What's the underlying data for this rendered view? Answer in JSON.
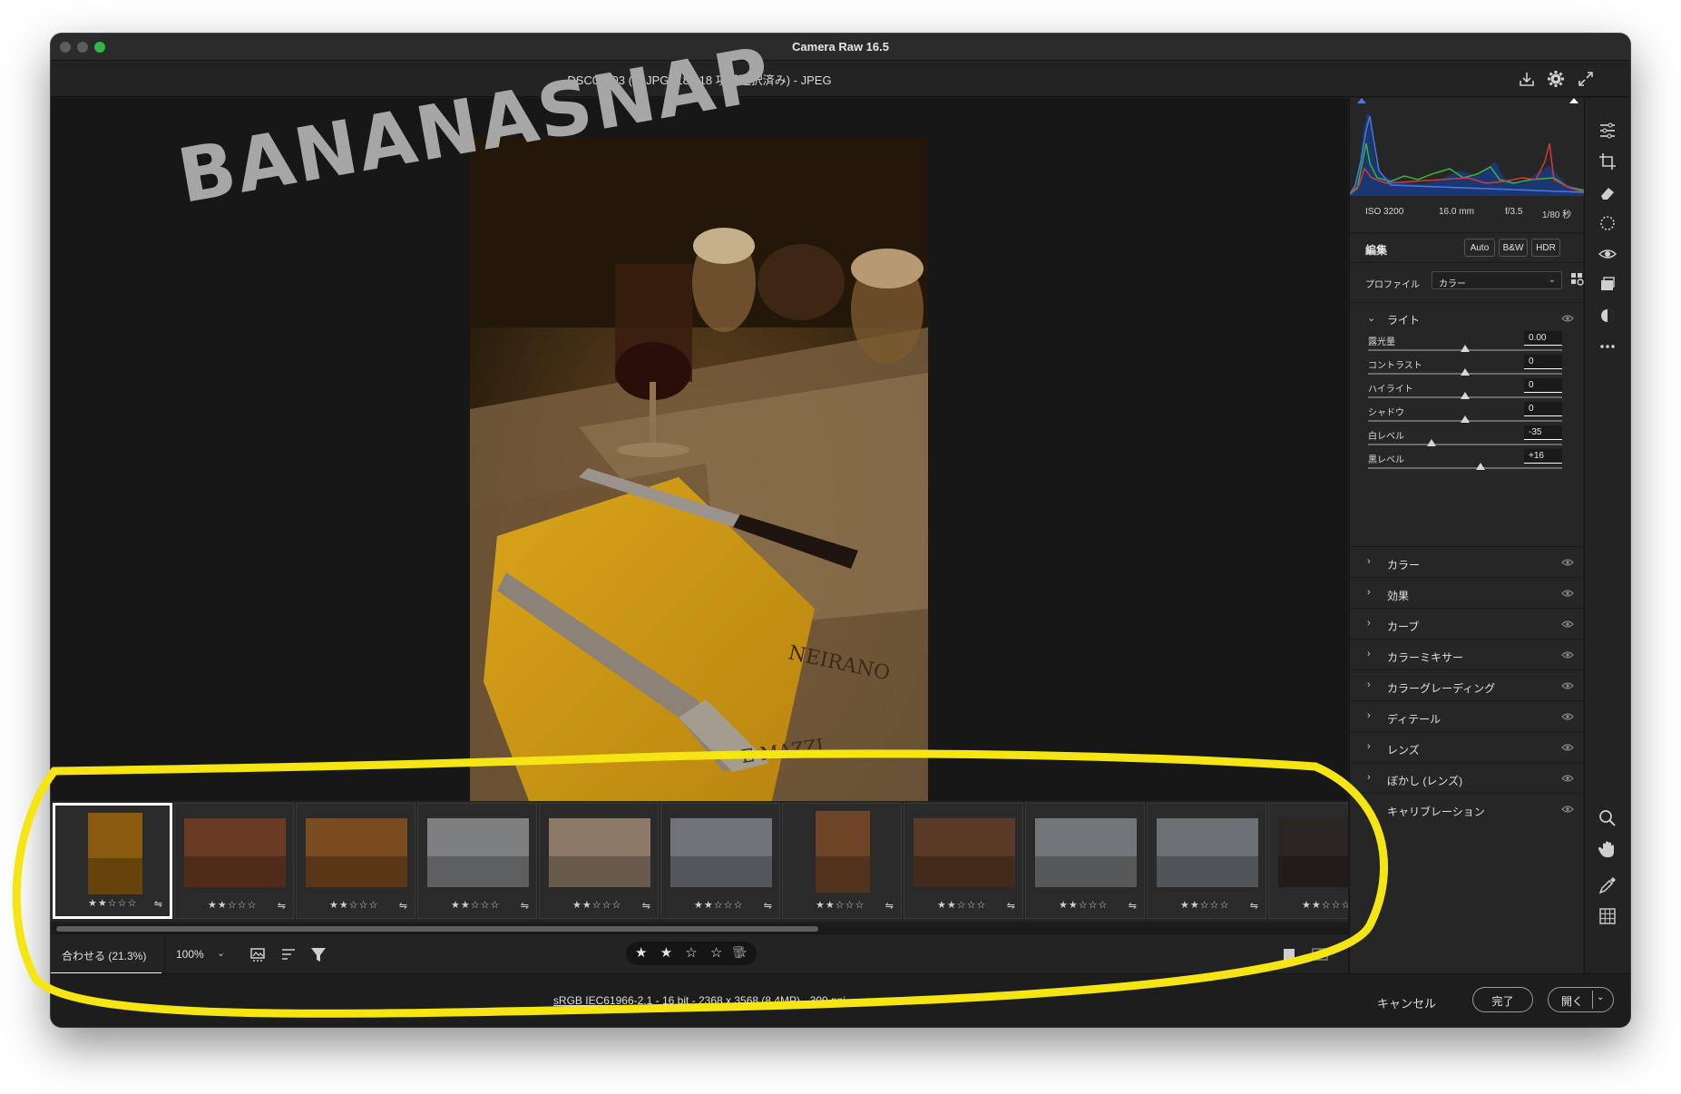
{
  "window": {
    "title": "Camera Raw 16.5"
  },
  "header": {
    "file_title": "DSC00003 (2).JPG (18 / 18 項目選択済み)  -  JPEG"
  },
  "icons": {
    "save": "download-icon",
    "settings": "gear-icon",
    "fullscreen": "expand-icon"
  },
  "watermark": "BANANASNAP",
  "annotation_color": "#f5e613",
  "histogram": {
    "exif": {
      "iso": "ISO 3200",
      "focal": "16.0 mm",
      "aperture": "f/3.5",
      "shutter": "1/80 秒"
    }
  },
  "edit": {
    "title": "編集",
    "buttons": [
      "Auto",
      "B&W",
      "HDR"
    ],
    "profile_label": "プロファイル",
    "profile_value": "カラー",
    "light": {
      "name": "ライト",
      "sliders": [
        {
          "label": "露光量",
          "value": "0.00",
          "position": 0.5
        },
        {
          "label": "コントラスト",
          "value": "0",
          "position": 0.5
        },
        {
          "label": "ハイライト",
          "value": "0",
          "position": 0.5
        },
        {
          "label": "シャドウ",
          "value": "0",
          "position": 0.5
        },
        {
          "label": "白レベル",
          "value": "-35",
          "position": 0.325
        },
        {
          "label": "黒レベル",
          "value": "+16",
          "position": 0.58
        }
      ]
    },
    "sections": [
      "カラー",
      "効果",
      "カーブ",
      "カラーミキサー",
      "カラーグレーディング",
      "ディテール",
      "レンズ",
      "ぼかし (レンズ)",
      "キャリブレーション"
    ]
  },
  "filmstrip": {
    "thumbnails": [
      {
        "stars": "★★☆☆☆",
        "selected": true,
        "tone": "#8a5a10"
      },
      {
        "stars": "★★☆☆☆",
        "selected": false,
        "tone": "#6b3a22"
      },
      {
        "stars": "★★☆☆☆",
        "selected": false,
        "tone": "#7a4a20"
      },
      {
        "stars": "★★☆☆☆",
        "selected": false,
        "tone": "#7d7f80"
      },
      {
        "stars": "★★☆☆☆",
        "selected": false,
        "tone": "#8c7a66"
      },
      {
        "stars": "★★☆☆☆",
        "selected": false,
        "tone": "#6f7378"
      },
      {
        "stars": "★★☆☆☆",
        "selected": false,
        "tone": "#6e4426"
      },
      {
        "stars": "★★☆☆☆",
        "selected": false,
        "tone": "#5a3a26"
      },
      {
        "stars": "★★☆☆☆",
        "selected": false,
        "tone": "#737679"
      },
      {
        "stars": "★★☆☆☆",
        "selected": false,
        "tone": "#6c7074"
      },
      {
        "stars": "★★☆☆☆",
        "selected": false,
        "tone": "#2a2622"
      }
    ],
    "flag_glyph": "⇋"
  },
  "toolbar": {
    "zoom_fit": "合わせる (21.3%)",
    "zoom_100": "100%",
    "rating": "★ ★ ☆ ☆ ☆"
  },
  "footer": {
    "file_info": "sRGB IEC61966-2.1 - 16 bit - 2368 x 3568 (8.4MP) - 300 ppi",
    "cancel": "キャンセル",
    "done": "完了",
    "open": "開く"
  }
}
